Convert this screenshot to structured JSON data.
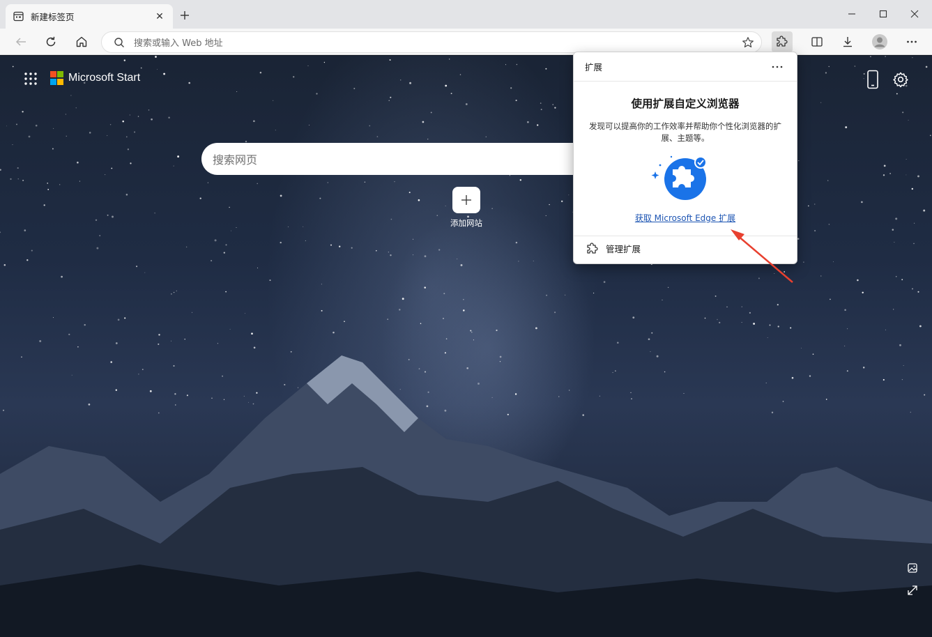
{
  "window": {
    "tab_title": "新建标签页",
    "tab_close": "✕",
    "new_tab": "+"
  },
  "toolbar": {
    "address_placeholder": "搜索或输入 Web 地址"
  },
  "newtab": {
    "brand": "Microsoft Start",
    "search_placeholder": "搜索网页",
    "quicklink_label": "添加网站"
  },
  "extensions_popup": {
    "title": "扩展",
    "heading": "使用扩展自定义浏览器",
    "description": "发现可以提高你的工作效率并帮助你个性化浏览器的扩展、主题等。",
    "get_link": "获取 Microsoft Edge 扩展",
    "manage": "管理扩展"
  },
  "icons": {
    "tab_favicon": "newtab-page-icon",
    "back": "back-arrow-icon",
    "refresh": "refresh-icon",
    "home": "home-icon",
    "search": "search-icon",
    "favorite": "star-icon",
    "extensions": "puzzle-icon",
    "split": "split-screen-icon",
    "downloads": "download-icon",
    "profile": "avatar-icon",
    "menu": "more-horizontal-icon",
    "apps": "apps-grid-icon",
    "phone": "phone-icon",
    "settings": "gear-icon",
    "bg_info": "image-info-icon",
    "expand": "expand-icon"
  },
  "colors": {
    "accent_link": "#1d55b3",
    "annotation_arrow": "#e8402f",
    "ms_red": "#f25022",
    "ms_green": "#7fba00",
    "ms_blue": "#00a4ef",
    "ms_yellow": "#ffb900"
  }
}
